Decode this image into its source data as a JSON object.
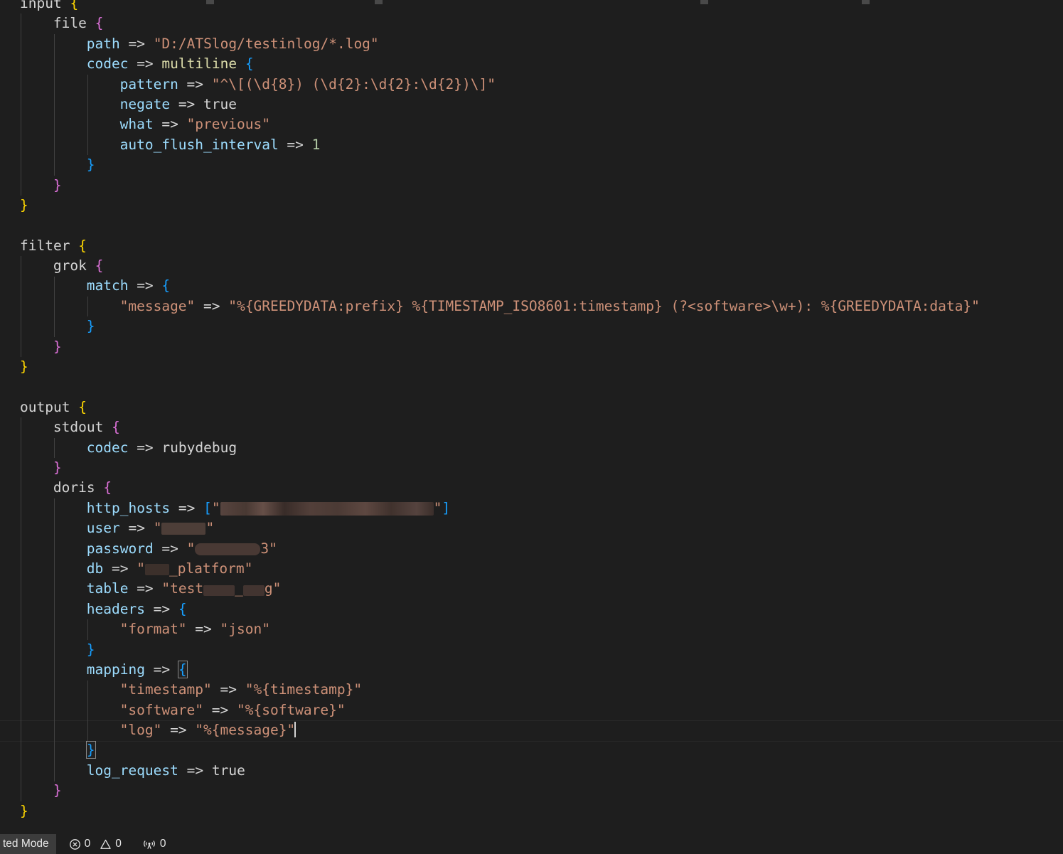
{
  "editor": {
    "language": "logstash-config",
    "lines": [
      {
        "indent": 0,
        "segments": [
          {
            "t": "input ",
            "c": "plain"
          },
          {
            "t": "{",
            "c": "b1"
          }
        ]
      },
      {
        "indent": 1,
        "segments": [
          {
            "t": "file ",
            "c": "plain"
          },
          {
            "t": "{",
            "c": "b2"
          }
        ]
      },
      {
        "indent": 2,
        "segments": [
          {
            "t": "path",
            "c": "prop"
          },
          {
            "t": " => ",
            "c": "op"
          },
          {
            "t": "\"D:/ATSlog/testinlog/*.log\"",
            "c": "str"
          }
        ]
      },
      {
        "indent": 2,
        "segments": [
          {
            "t": "codec",
            "c": "prop"
          },
          {
            "t": " => ",
            "c": "op"
          },
          {
            "t": "multiline",
            "c": "ident"
          },
          {
            "t": " ",
            "c": "plain"
          },
          {
            "t": "{",
            "c": "b3"
          }
        ]
      },
      {
        "indent": 3,
        "segments": [
          {
            "t": "pattern",
            "c": "prop"
          },
          {
            "t": " => ",
            "c": "op"
          },
          {
            "t": "\"^\\[(\\d{8}) (\\d{2}:\\d{2}:\\d{2})\\]\"",
            "c": "str"
          }
        ]
      },
      {
        "indent": 3,
        "segments": [
          {
            "t": "negate",
            "c": "prop"
          },
          {
            "t": " => ",
            "c": "op"
          },
          {
            "t": "true",
            "c": "plain"
          }
        ]
      },
      {
        "indent": 3,
        "segments": [
          {
            "t": "what",
            "c": "prop"
          },
          {
            "t": " => ",
            "c": "op"
          },
          {
            "t": "\"previous\"",
            "c": "str"
          }
        ]
      },
      {
        "indent": 3,
        "segments": [
          {
            "t": "auto_flush_interval",
            "c": "prop"
          },
          {
            "t": " => ",
            "c": "op"
          },
          {
            "t": "1",
            "c": "num"
          }
        ]
      },
      {
        "indent": 2,
        "segments": [
          {
            "t": "}",
            "c": "b3"
          }
        ]
      },
      {
        "indent": 1,
        "segments": [
          {
            "t": "}",
            "c": "b2"
          }
        ]
      },
      {
        "indent": 0,
        "segments": [
          {
            "t": "}",
            "c": "b1"
          }
        ]
      },
      {
        "indent": 0,
        "segments": []
      },
      {
        "indent": 0,
        "segments": [
          {
            "t": "filter ",
            "c": "plain"
          },
          {
            "t": "{",
            "c": "b1"
          }
        ]
      },
      {
        "indent": 1,
        "segments": [
          {
            "t": "grok ",
            "c": "plain"
          },
          {
            "t": "{",
            "c": "b2"
          }
        ]
      },
      {
        "indent": 2,
        "segments": [
          {
            "t": "match",
            "c": "prop"
          },
          {
            "t": " => ",
            "c": "op"
          },
          {
            "t": "{",
            "c": "b3"
          }
        ]
      },
      {
        "indent": 3,
        "segments": [
          {
            "t": "\"message\"",
            "c": "str"
          },
          {
            "t": " => ",
            "c": "op"
          },
          {
            "t": "\"%{GREEDYDATA:prefix} %{TIMESTAMP_ISO8601:timestamp} (?<software>\\w+): %{GREEDYDATA:data}\"",
            "c": "str"
          }
        ]
      },
      {
        "indent": 2,
        "segments": [
          {
            "t": "}",
            "c": "b3"
          }
        ]
      },
      {
        "indent": 1,
        "segments": [
          {
            "t": "}",
            "c": "b2"
          }
        ]
      },
      {
        "indent": 0,
        "segments": [
          {
            "t": "}",
            "c": "b1"
          }
        ]
      },
      {
        "indent": 0,
        "segments": []
      },
      {
        "indent": 0,
        "segments": [
          {
            "t": "output ",
            "c": "plain"
          },
          {
            "t": "{",
            "c": "b1"
          }
        ]
      },
      {
        "indent": 1,
        "segments": [
          {
            "t": "stdout ",
            "c": "plain"
          },
          {
            "t": "{",
            "c": "b2"
          }
        ]
      },
      {
        "indent": 2,
        "segments": [
          {
            "t": "codec",
            "c": "prop"
          },
          {
            "t": " => ",
            "c": "op"
          },
          {
            "t": "rubydebug",
            "c": "plain"
          }
        ]
      },
      {
        "indent": 1,
        "segments": [
          {
            "t": "}",
            "c": "b2"
          }
        ]
      },
      {
        "indent": 1,
        "segments": [
          {
            "t": "doris ",
            "c": "plain"
          },
          {
            "t": "{",
            "c": "b2"
          }
        ]
      },
      {
        "indent": 2,
        "segments": [
          {
            "t": "http_hosts",
            "c": "prop"
          },
          {
            "t": " => ",
            "c": "op"
          },
          {
            "t": "[",
            "c": "b3"
          },
          {
            "t": "\"",
            "c": "str"
          },
          {
            "redact": "host"
          },
          {
            "t": "\"",
            "c": "str"
          },
          {
            "t": "]",
            "c": "b3"
          }
        ]
      },
      {
        "indent": 2,
        "segments": [
          {
            "t": "user",
            "c": "prop"
          },
          {
            "t": " => ",
            "c": "op"
          },
          {
            "t": "\"",
            "c": "str"
          },
          {
            "redact": "user"
          },
          {
            "t": "\"",
            "c": "str"
          }
        ]
      },
      {
        "indent": 2,
        "segments": [
          {
            "t": "password",
            "c": "prop"
          },
          {
            "t": " => ",
            "c": "op"
          },
          {
            "t": "\"",
            "c": "str"
          },
          {
            "redact": "pass"
          },
          {
            "t": "3\"",
            "c": "str"
          }
        ]
      },
      {
        "indent": 2,
        "segments": [
          {
            "t": "db",
            "c": "prop"
          },
          {
            "t": " => ",
            "c": "op"
          },
          {
            "t": "\"",
            "c": "str"
          },
          {
            "redact": "db"
          },
          {
            "t": "_platform\"",
            "c": "str"
          }
        ]
      },
      {
        "indent": 2,
        "segments": [
          {
            "t": "table",
            "c": "prop"
          },
          {
            "t": " => ",
            "c": "op"
          },
          {
            "t": "\"test",
            "c": "str"
          },
          {
            "redact": "tbl1"
          },
          {
            "t": "_",
            "c": "str"
          },
          {
            "redact": "tbl2"
          },
          {
            "t": "g\"",
            "c": "str"
          }
        ]
      },
      {
        "indent": 2,
        "segments": [
          {
            "t": "headers",
            "c": "prop"
          },
          {
            "t": " => ",
            "c": "op"
          },
          {
            "t": "{",
            "c": "b3"
          }
        ]
      },
      {
        "indent": 3,
        "segments": [
          {
            "t": "\"format\"",
            "c": "str"
          },
          {
            "t": " => ",
            "c": "op"
          },
          {
            "t": "\"json\"",
            "c": "str"
          }
        ]
      },
      {
        "indent": 2,
        "segments": [
          {
            "t": "}",
            "c": "b3"
          }
        ]
      },
      {
        "indent": 2,
        "segments": [
          {
            "t": "mapping",
            "c": "prop"
          },
          {
            "t": " => ",
            "c": "op"
          },
          {
            "t": "{",
            "c": "b3",
            "match": true
          }
        ]
      },
      {
        "indent": 3,
        "segments": [
          {
            "t": "\"timestamp\"",
            "c": "str"
          },
          {
            "t": " => ",
            "c": "op"
          },
          {
            "t": "\"%{timestamp}\"",
            "c": "str"
          }
        ]
      },
      {
        "indent": 3,
        "segments": [
          {
            "t": "\"software\"",
            "c": "str"
          },
          {
            "t": " => ",
            "c": "op"
          },
          {
            "t": "\"%{software}\"",
            "c": "str"
          }
        ]
      },
      {
        "indent": 3,
        "current": true,
        "segments": [
          {
            "t": "\"log\"",
            "c": "str"
          },
          {
            "t": " => ",
            "c": "op"
          },
          {
            "t": "\"%{message}\"",
            "c": "str"
          },
          {
            "cursor": true
          }
        ]
      },
      {
        "indent": 2,
        "segments": [
          {
            "t": "}",
            "c": "b3",
            "match": true
          }
        ]
      },
      {
        "indent": 2,
        "segments": [
          {
            "t": "log_request",
            "c": "prop"
          },
          {
            "t": " => ",
            "c": "op"
          },
          {
            "t": "true",
            "c": "plain"
          }
        ]
      },
      {
        "indent": 1,
        "segments": [
          {
            "t": "}",
            "c": "b2"
          }
        ]
      },
      {
        "indent": 0,
        "segments": [
          {
            "t": "}",
            "c": "b1"
          }
        ]
      }
    ]
  },
  "status_bar": {
    "restricted_mode_label": "ted Mode",
    "errors_icon": "error-circle-icon",
    "errors_count": "0",
    "warnings_icon": "warning-triangle-icon",
    "warnings_count": "0",
    "ports_icon": "radio-tower-icon",
    "ports_count": "0"
  },
  "theme": {
    "background": "#1e1e1e",
    "foreground": "#d4d4d4",
    "property": "#9cdcfe",
    "string": "#ce9178",
    "number": "#b5cea8",
    "identifier": "#dcdcaa",
    "bracket_level_1": "#ffd700",
    "bracket_level_2": "#da70d6",
    "bracket_level_3": "#179fff",
    "indent_guide": "#404040",
    "current_line_border": "#282828",
    "status_bar_background": "#1e1e1e",
    "restricted_badge_background": "#3c3c3c"
  }
}
